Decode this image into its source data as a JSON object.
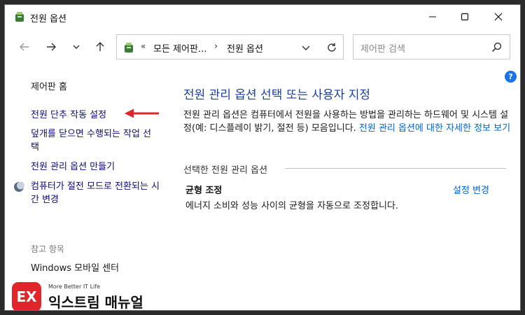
{
  "window": {
    "title": "전원 옵션"
  },
  "address": {
    "crumb_chevron": "«",
    "crumb1": "모든 제어판...",
    "separator": "›",
    "crumb2": "전원 옵션"
  },
  "search": {
    "placeholder": "제어판 검색"
  },
  "sidebar": {
    "home": "제어판 홈",
    "item1": "전원 단추 작동 설정",
    "item2": "덮개를 닫으면 수행되는 작업 선택",
    "item3": "전원 관리 옵션 만들기",
    "item4": "컴퓨터가 절전 모드로 전환되는 시간 변경",
    "see_also_heading": "참고 항목",
    "see_also_item1": "Windows 모바일 센터"
  },
  "main": {
    "title": "전원 관리 옵션 선택 또는 사용자 지정",
    "desc_text": "전원 관리 옵션은 컴퓨터에서 전원을 사용하는 방법을 관리하는 하드웨어 및 시스템 설정(예: 디스플레이 밝기, 절전 등) 모음입니다. ",
    "desc_link": "전원 관리 옵션에 대한 자세한 정보 보기",
    "section_heading": "선택한 전원 관리 옵션",
    "plan_name": "균형 조정",
    "plan_change": "설정 변경",
    "plan_desc": "에너지 소비와 성능 사이의 균형을 자동으로 조정합니다."
  },
  "help": {
    "label": "?"
  },
  "brand": {
    "badge": "EX",
    "tagline": "More Better IT Life",
    "name": "익스트림 매뉴얼"
  },
  "colors": {
    "link": "#0066cc",
    "nav_link": "#0b0b7a",
    "title": "#1a3f9e",
    "arrow": "#e0262b"
  }
}
